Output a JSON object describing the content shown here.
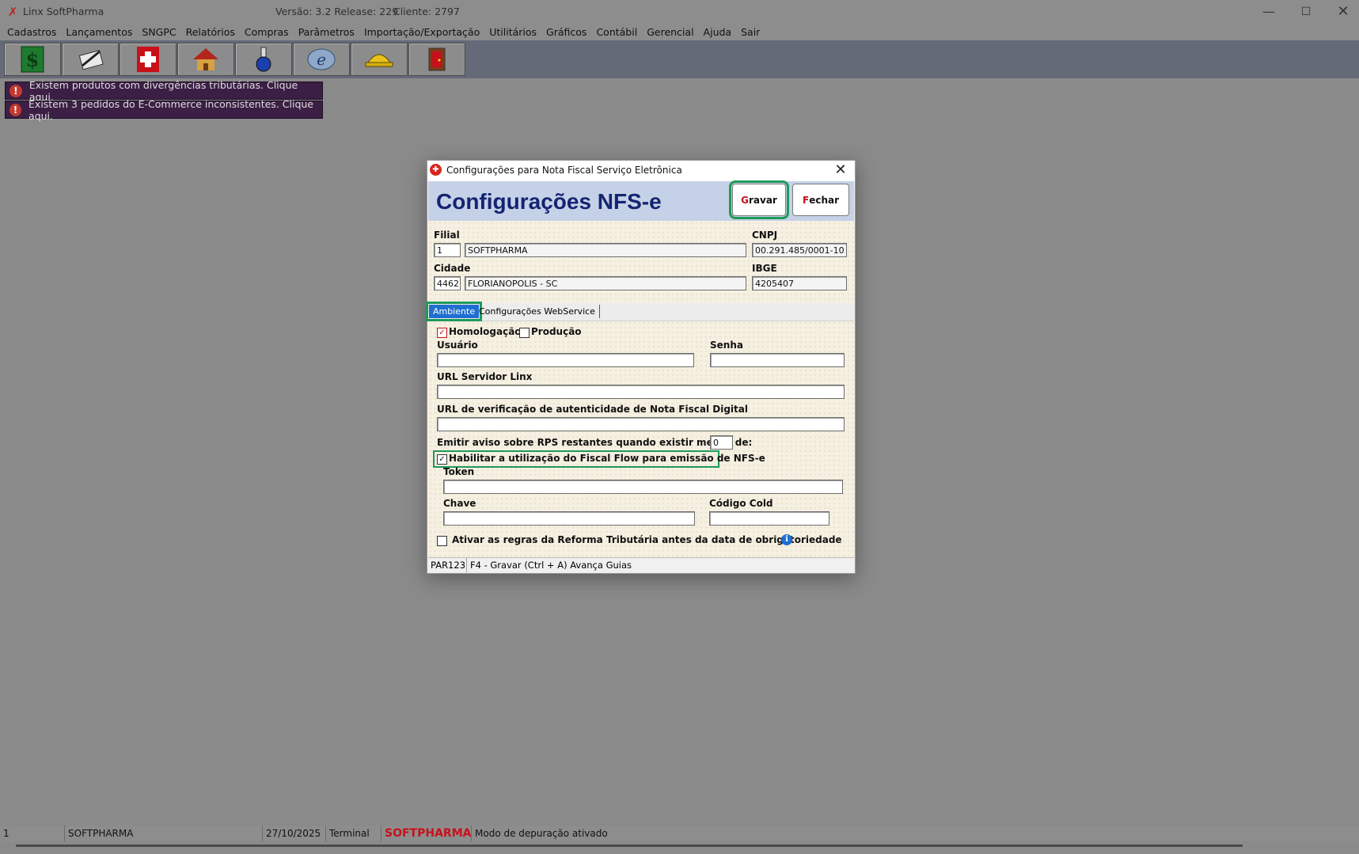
{
  "window": {
    "app_title": "Linx SoftPharma",
    "version": "Versão: 3.2 Release: 229",
    "client": "Cliente: 2797"
  },
  "menu": [
    "Cadastros",
    "Lançamentos",
    "SNGPC",
    "Relatórios",
    "Compras",
    "Parâmetros",
    "Importação/Exportação",
    "Utilitários",
    "Gráficos",
    "Contábil",
    "Gerencial",
    "Ajuda",
    "Sair"
  ],
  "toolbar": {
    "buttons": [
      "dollar-icon",
      "notepad-icon",
      "pharmacy-cross-icon",
      "house-icon",
      "flask-icon",
      "nfe-icon",
      "helmet-icon",
      "exit-door-icon"
    ]
  },
  "alerts": [
    "Existem produtos com divergências tributárias. Clique aqui.",
    "Existem 3 pedidos do E-Commerce inconsistentes. Clique aqui."
  ],
  "dialog": {
    "title": "Configurações para Nota Fiscal Serviço Eletrônica",
    "heading": "Configurações NFS-e",
    "save_button": "Gravar",
    "close_button": "Fechar",
    "filial_label": "Filial",
    "filial_code": "1",
    "filial_name": "SOFTPHARMA",
    "cnpj_label": "CNPJ",
    "cnpj_value": "00.291.485/0001-10",
    "cidade_label": "Cidade",
    "cidade_code": "4462",
    "cidade_name": "FLORIANOPOLIS - SC",
    "ibge_label": "IBGE",
    "ibge_value": "4205407",
    "tabs": [
      "Ambiente",
      "Configurações WebService"
    ],
    "homologacao_label": "Homologação",
    "homologacao_checked": true,
    "producao_label": "Produção",
    "producao_checked": false,
    "usuario_label": "Usuário",
    "senha_label": "Senha",
    "url_servidor_label": "URL Servidor Linx",
    "url_verificacao_label": "URL de verificação de autenticidade de Nota Fiscal Digital",
    "aviso_rps_label": "Emitir aviso sobre RPS restantes quando existir menos de:",
    "aviso_rps_value": "0",
    "fiscal_flow_label": "Habilitar a utilização do Fiscal Flow para emissão de NFS-e",
    "fiscal_flow_checked": true,
    "token_label": "Token",
    "chave_label": "Chave",
    "codigo_cold_label": "Código Cold",
    "reforma_label": "Ativar as regras da Reforma Tributária antes da data de obrigatoriedade",
    "reforma_checked": false,
    "status_code": "PAR123",
    "status_hint": "F4 - Gravar  (Ctrl + A) Avança Guias"
  },
  "statusbar": {
    "c1": "1",
    "c2": "SOFTPHARMA",
    "c3": "27/10/2025",
    "c4": "Terminal",
    "c5": "SOFTPHARMA",
    "c6": "Modo de depuração ativado"
  },
  "colors": {
    "heading": "#142472",
    "highlight": "#1e9a5a",
    "tab_active": "#1f6fd0",
    "alert_bg": "#3c1f45"
  }
}
